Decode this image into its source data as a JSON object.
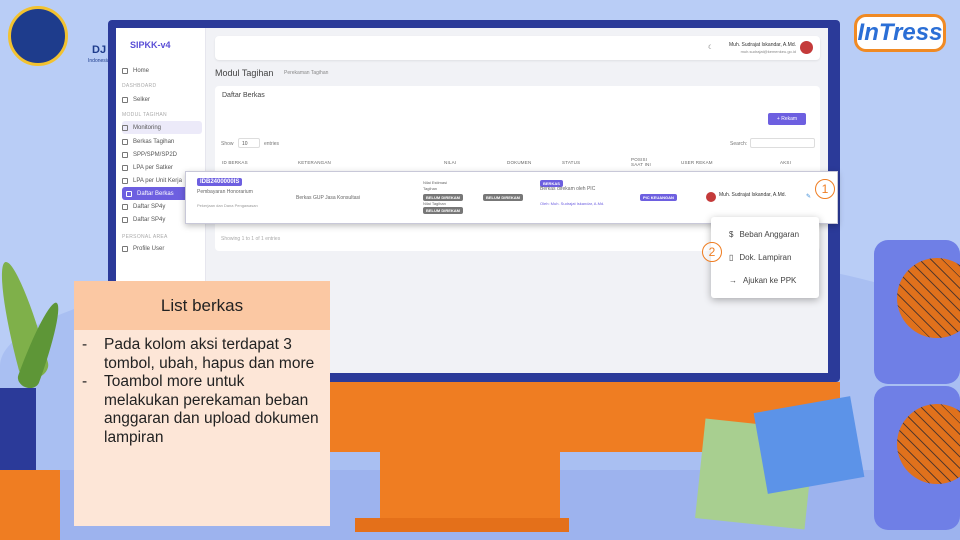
{
  "logos": {
    "left_text": "DJ",
    "left_sub": "Indonesia",
    "right": "InTress"
  },
  "sidebar": {
    "brand": "SIPKK-v4",
    "home": "Home",
    "dashboard": "DASHBOARD",
    "selker": "Selker",
    "modul": "MODUL TAGIHAN",
    "monitoring": "Monitoring",
    "items": [
      "Berkas Tagihan",
      "SPP/SPM/SP2D",
      "LPA per Satker",
      "LPA per Unit Kerja",
      "Daftar Berkas",
      "Daftar SP4y",
      "Daftar SP4y"
    ],
    "personal": "PERSONAL AREA",
    "profile": "Profile User"
  },
  "topbar": {
    "user": "Muh. Sudrajat Iskandar, A.Md.",
    "email": "muh.sudrajat@kemenkeu.go.id"
  },
  "page": {
    "title": "Modul Tagihan",
    "crumb": "Perekaman Tagihan",
    "card_title": "Daftar Berkas",
    "rekam": "+ Rekam",
    "show": "Show",
    "show_val": "10",
    "entries": "entries",
    "search": "Search:",
    "showing": "Showing 1 to 1 of 1 entries"
  },
  "table": {
    "headers": [
      "ID BERKAS",
      "KETERANGAN",
      "NILAI",
      "DOKUMEN",
      "STATUS",
      "POSISI SAAT INI",
      "USER REKAM",
      "AKSI"
    ]
  },
  "row": {
    "id": "IDB2400000IS",
    "desc1": "Pembayaran Honorarium",
    "desc2": "Pekerjaan dan Dana Pengawasan",
    "ket": "Berkas GUP Jasa Konsultasi",
    "nilai1": "Nilai Estimasi",
    "nilai2": "Tagihan",
    "nilai_badge": "BELUM DIREKAM",
    "nilai3": "Nilai Tagihan",
    "dok": "BELUM DIREKAM",
    "status_badge": "BERKAS",
    "status": "Berkas direkam oleh PIC",
    "status_by": "Oleh: Muh. Sudrajat Iskandar, A.Md.",
    "posisi": "PIC KEUANGAN",
    "user": "Muh. Sudrajat Iskandar, A.Md."
  },
  "dropdown": [
    "Beban Anggaran",
    "Dok. Lampiran",
    "Ajukan ke PPK"
  ],
  "callouts": [
    "1",
    "2"
  ],
  "note": {
    "title": "List berkas",
    "points": [
      "Pada kolom aksi terdapat 3 tombol, ubah, hapus dan more",
      "Toambol more untuk melakukan perekaman beban anggaran dan upload dokumen lampiran"
    ]
  },
  "colors": {
    "accent": "#6d5fe0",
    "orange": "#ef7d22",
    "monitor": "#2b3a99"
  }
}
